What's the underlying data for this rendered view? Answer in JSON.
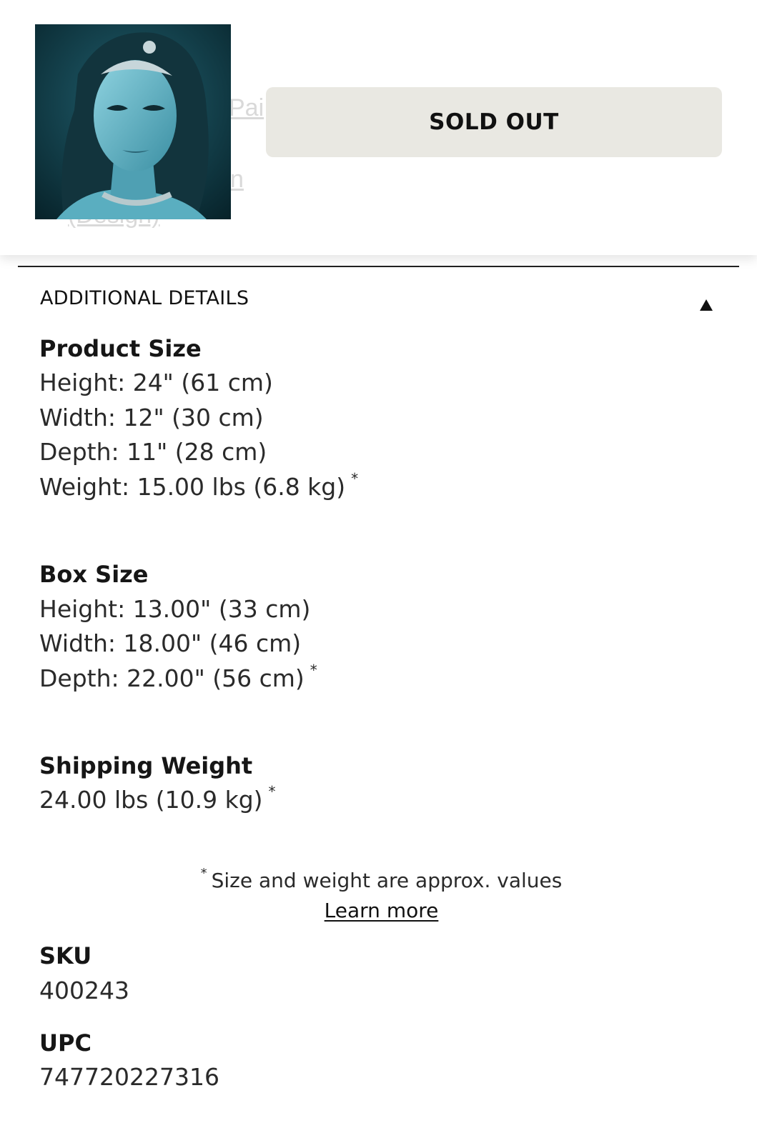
{
  "header": {
    "button_label": "SOLD OUT",
    "faded_links": [
      "Pai",
      "n",
      "(Design)"
    ]
  },
  "section": {
    "title": "ADDITIONAL DETAILS",
    "toggle_icon": "triangle-up-icon"
  },
  "product_size": {
    "heading": "Product Size",
    "height": "Height: 24\" (61 cm)",
    "width": "Width: 12\" (30 cm)",
    "depth": "Depth: 11\" (28 cm)",
    "weight": "Weight: 15.00 lbs (6.8 kg)",
    "weight_mark": "*"
  },
  "box_size": {
    "heading": "Box Size",
    "height": "Height: 13.00\" (33 cm)",
    "width": "Width: 18.00\" (46 cm)",
    "depth": "Depth: 22.00\" (56 cm)",
    "depth_mark": "*"
  },
  "shipping": {
    "heading": "Shipping Weight",
    "value": "24.00 lbs (10.9 kg)",
    "mark": "*"
  },
  "note": {
    "mark": "*",
    "text": "Size and weight are approx. values",
    "link": "Learn more"
  },
  "sku": {
    "heading": "SKU",
    "value": "400243"
  },
  "upc": {
    "heading": "UPC",
    "value": "747720227316"
  },
  "colors": {
    "button_bg": "#e9e8e2",
    "text": "#1b1b1b",
    "faded_link": "#d9d9d9"
  }
}
